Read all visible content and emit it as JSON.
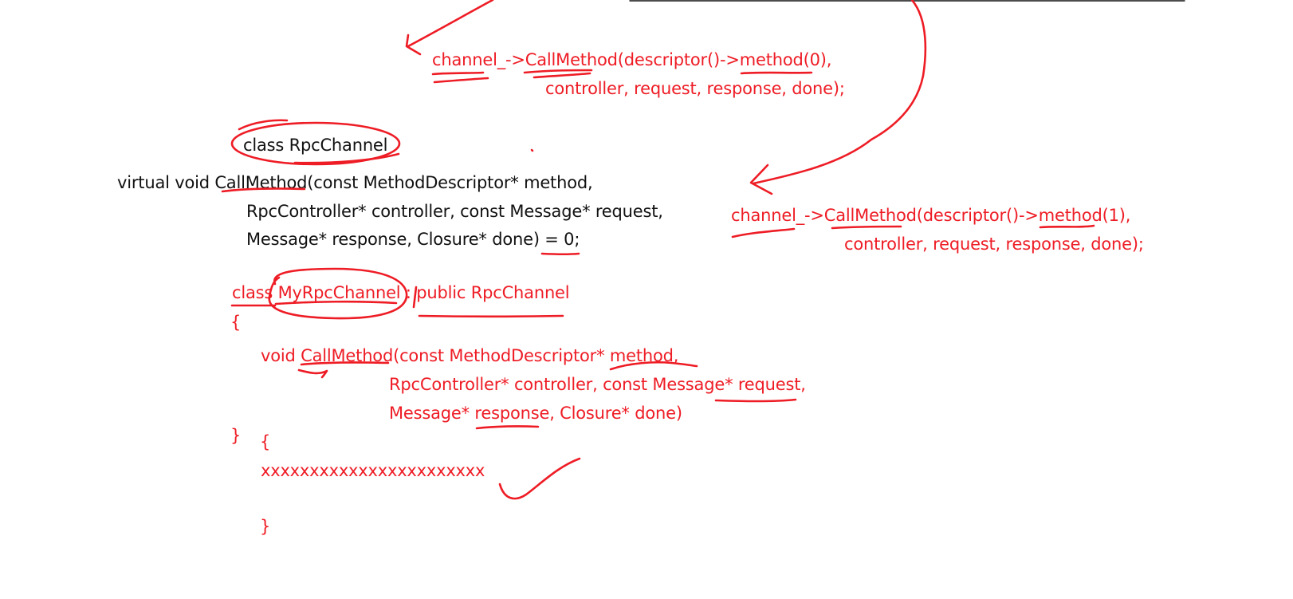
{
  "annotations": {
    "call_top": {
      "line1": "channel_->CallMethod(descriptor()->method(0),",
      "line2": "controller, request, response, done);"
    },
    "call_right": {
      "line1": "channel_->CallMethod(descriptor()->method(1),",
      "line2": "controller, request, response, done);"
    }
  },
  "base_class": {
    "name": "class RpcChannel",
    "signature_line1": "virtual void CallMethod(const MethodDescriptor* method,",
    "signature_line2": "RpcController* controller, const Message* request,",
    "signature_line3": "Message* response, Closure* done) = 0;"
  },
  "derived_class": {
    "declaration": "class MyRpcChannel : public RpcChannel",
    "open_brace": "{",
    "method_line1": "void CallMethod(const MethodDescriptor* method,",
    "method_line2": "RpcController* controller, const Message* request,",
    "method_line3": "Message* response, Closure* done)",
    "close_brace_class": "}",
    "body_open": "{",
    "body": "xxxxxxxxxxxxxxxxxxxxxxx",
    "body_close": "}"
  },
  "colors": {
    "ink": "#ee1c25",
    "text": "#111111"
  }
}
